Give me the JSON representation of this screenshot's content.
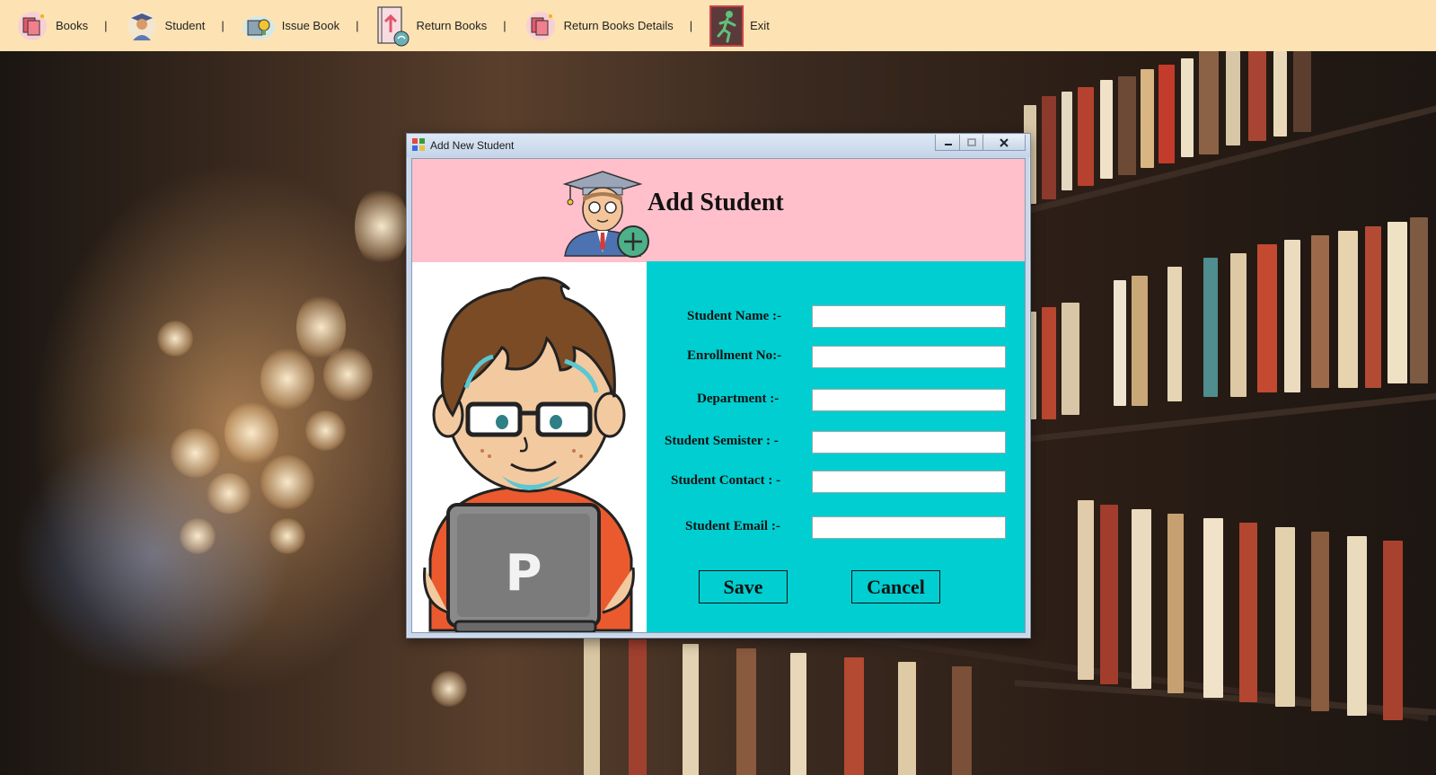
{
  "menu": {
    "items": [
      {
        "label": "Books",
        "icon": "books-icon"
      },
      {
        "label": "Student",
        "icon": "student-icon"
      },
      {
        "label": "Issue Book",
        "icon": "issue-book-icon"
      },
      {
        "label": "Return Books",
        "icon": "return-books-icon"
      },
      {
        "label": "Return Books Details",
        "icon": "return-books-details-icon"
      },
      {
        "label": "Exit",
        "icon": "exit-icon"
      }
    ],
    "separator": "|"
  },
  "dialog": {
    "title": "Add New Student",
    "header_title": "Add Student",
    "fields": [
      {
        "label": "Student Name :-",
        "value": "",
        "placeholder": ""
      },
      {
        "label": "Enrollment No:-",
        "value": "",
        "placeholder": ""
      },
      {
        "label": "Department :-",
        "value": "",
        "placeholder": ""
      },
      {
        "label": "Student Semister : -",
        "value": "",
        "placeholder": ""
      },
      {
        "label": "Student Contact : -",
        "value": "",
        "placeholder": ""
      },
      {
        "label": "Student Email :-",
        "value": "",
        "placeholder": ""
      }
    ],
    "save_label": "Save",
    "cancel_label": "Cancel",
    "laptop_letter": "P"
  },
  "colors": {
    "menubar": "#fde2b3",
    "header": "#ffc0cb",
    "form_bg": "#00ced1"
  }
}
